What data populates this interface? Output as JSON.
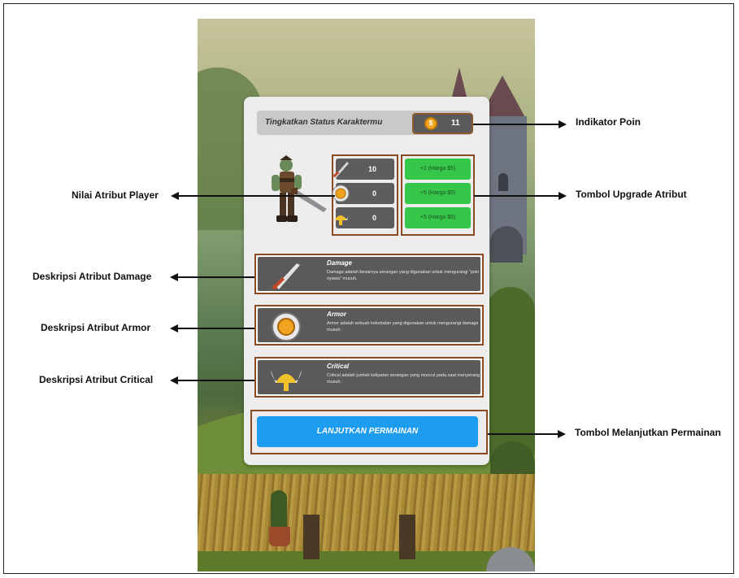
{
  "panel": {
    "title": "Tingkatkan Status Karaktermu",
    "coin_symbol": "$",
    "points": "11"
  },
  "attributes": [
    {
      "icon": "sword-icon",
      "value": "10"
    },
    {
      "icon": "shield-icon",
      "value": "0"
    },
    {
      "icon": "helmet-icon",
      "value": "0"
    }
  ],
  "upgrades": [
    {
      "label": "+2  (Harga $5)"
    },
    {
      "label": "+5 (Harga $5)"
    },
    {
      "label": "+5 (Harga $5)"
    }
  ],
  "descriptions": [
    {
      "icon": "sword-icon",
      "title": "Damage",
      "body": "Damage adalah besarnya serangan yang digunakan untuk mengurangi \"poin nyawa\" musuh."
    },
    {
      "icon": "shield-icon",
      "title": "Armor",
      "body": "Armor adalah sebuah kekebalan yang digunakan untuk mengurangi damage musuh."
    },
    {
      "icon": "helmet-icon",
      "title": "Critical",
      "body": "Critical adalah jumlah kelipatan serangan yang muncul pada saat menyerang musuh."
    }
  ],
  "continue_button": "LANJUTKAN PERMAINAN",
  "callouts": {
    "indikator_poin": "Indikator Poin",
    "nilai_atribut": "Nilai Atribut Player",
    "tombol_upgrade": "Tombol Upgrade Atribut",
    "desk_damage": "Deskripsi Atribut Damage",
    "desk_armor": "Deskripsi Atribut Armor",
    "desk_critical": "Deskripsi Atribut Critical",
    "tombol_lanjut": "Tombol Melanjutkan Permainan"
  },
  "colors": {
    "upgrade_green": "#35c64a",
    "continue_blue": "#1d9cf0",
    "highlight_border": "#8b4b22",
    "panel_bg": "#ececec"
  }
}
